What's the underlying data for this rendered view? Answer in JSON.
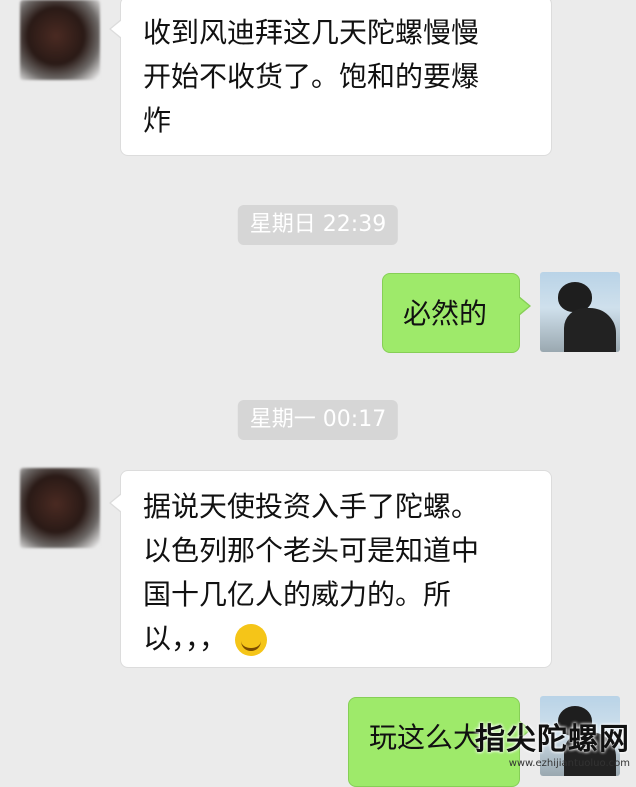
{
  "messages": [
    {
      "side": "left",
      "lines": [
        "收到风迪拜这几天陀螺慢慢",
        "开始不收货了。饱和的要爆",
        "炸"
      ]
    },
    {
      "timestamp": "星期日 22:39"
    },
    {
      "side": "right",
      "lines": [
        "必然的"
      ]
    },
    {
      "timestamp": "星期一 00:17"
    },
    {
      "side": "left",
      "lines": [
        "据说天使投资入手了陀螺。",
        "以色列那个老头可是知道中",
        "国十几亿人的威力的。所",
        "以，，，"
      ],
      "emoji": "facepalm-laugh-emoji"
    },
    {
      "side": "right",
      "lines": [
        "玩这么大"
      ]
    }
  ],
  "watermark": {
    "title": "指尖陀螺网",
    "url": "www.ezhijiantuoluo.com"
  },
  "colors": {
    "background": "#ebebeb",
    "left_bubble": "#ffffff",
    "right_bubble": "#9eea6a",
    "timestamp_bg": "#d6d6d6"
  }
}
